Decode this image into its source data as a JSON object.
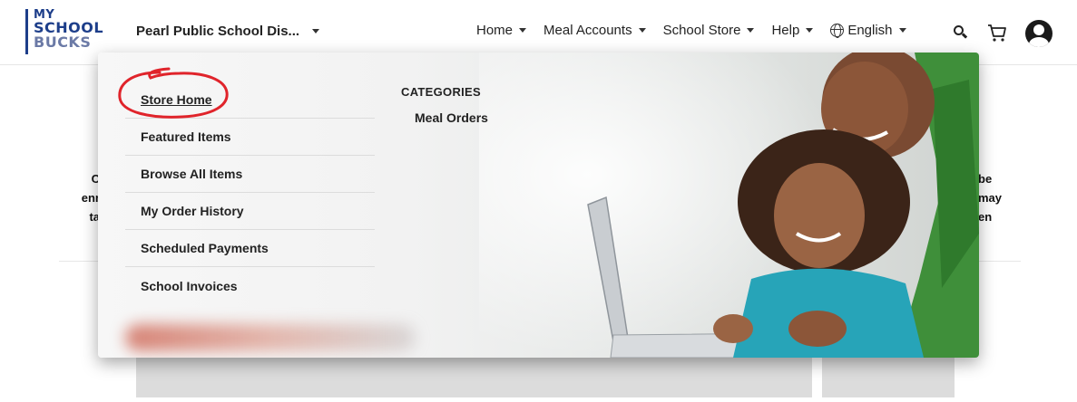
{
  "logo": {
    "line1": "MY",
    "line2": "SCHOOL",
    "line3": "BUCKS"
  },
  "district": {
    "label": "Pearl Public School Dis..."
  },
  "nav": {
    "items": [
      {
        "label": "Home"
      },
      {
        "label": "Meal Accounts"
      },
      {
        "label": "School Store"
      },
      {
        "label": "Help"
      },
      {
        "label": "English"
      }
    ],
    "icons": [
      "globe-icon",
      "search-icon",
      "cart-icon",
      "user-icon"
    ]
  },
  "dropdown": {
    "menu": [
      {
        "label": "Store Home"
      },
      {
        "label": "Featured Items"
      },
      {
        "label": "Browse All Items"
      },
      {
        "label": "My Order History"
      },
      {
        "label": "Scheduled Payments"
      },
      {
        "label": "School Invoices"
      }
    ],
    "categories_title": "CATEGORIES",
    "categories": [
      {
        "label": "Meal Orders"
      }
    ]
  },
  "background": {
    "left_text": [
      "C",
      "enr",
      "ta"
    ],
    "right_text": [
      "be",
      "may",
      "en"
    ]
  },
  "colors": {
    "brand": "#1d3e8a",
    "annotation": "#e0242b"
  }
}
